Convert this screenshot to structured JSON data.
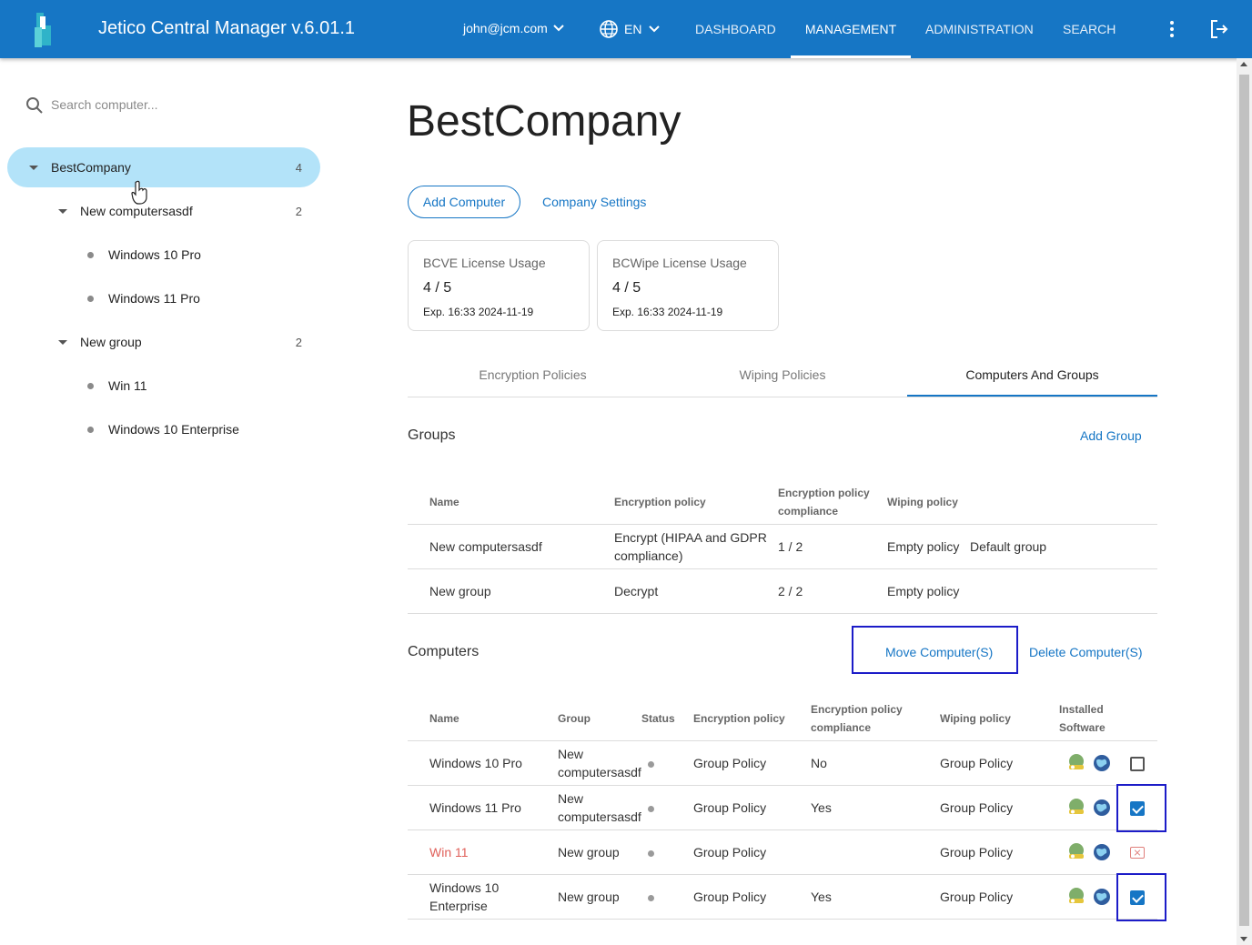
{
  "header": {
    "app_title": "Jetico Central Manager  v.6.01.1",
    "user": "john@jcm.com",
    "language": "EN",
    "nav": [
      {
        "label": "DASHBOARD"
      },
      {
        "label": "MANAGEMENT"
      },
      {
        "label": "ADMINISTRATION"
      },
      {
        "label": "SEARCH"
      }
    ],
    "active_nav": "MANAGEMENT",
    "colors": {
      "bar": "#1676c5",
      "accent": "#1676c5",
      "selected_tree": "#b3e3f9",
      "highlight": "#1c1cc8",
      "danger": "#e0605a"
    }
  },
  "sidebar": {
    "search_placeholder": "Search computer...",
    "tree": {
      "root": {
        "label": "BestCompany",
        "count": "4"
      },
      "groups": [
        {
          "label": "New computersasdf",
          "count": "2",
          "children": [
            "Windows 10 Pro",
            "Windows 11 Pro"
          ]
        },
        {
          "label": "New group",
          "count": "2",
          "children": [
            "Win 11",
            "Windows 10 Enterprise"
          ]
        }
      ]
    }
  },
  "main": {
    "title": "BestCompany",
    "add_computer": "Add Computer",
    "company_settings": "Company Settings",
    "cards": [
      {
        "title": "BCVE License Usage",
        "value": "4 / 5",
        "exp": "Exp. 16:33 2024-11-19"
      },
      {
        "title": "BCWipe License Usage",
        "value": "4 / 5",
        "exp": "Exp. 16:33 2024-11-19"
      }
    ],
    "tabs": [
      "Encryption Policies",
      "Wiping Policies",
      "Computers And Groups"
    ],
    "active_tab": "Computers And Groups",
    "groups": {
      "title": "Groups",
      "add_group": "Add Group",
      "headers": {
        "name": "Name",
        "enc_policy": "Encryption policy",
        "enc_compliance_1": "Encryption policy",
        "enc_compliance_2": "compliance",
        "wiping": "Wiping policy"
      },
      "rows": [
        {
          "name": "New computersasdf",
          "enc_policy": "Encrypt (HIPAA and GDPR compliance)",
          "compliance": "1 / 2",
          "wiping": "Empty policy",
          "extra": "Default group"
        },
        {
          "name": "New group",
          "enc_policy": "Decrypt",
          "compliance": "2 / 2",
          "wiping": "Empty policy",
          "extra": ""
        }
      ]
    },
    "computers": {
      "title": "Computers",
      "move": "Move Computer(S)",
      "delete": "Delete Computer(S)",
      "headers": {
        "name": "Name",
        "group": "Group",
        "status": "Status",
        "enc_policy": "Encryption policy",
        "enc_compliance_1": "Encryption policy",
        "enc_compliance_2": "compliance",
        "wiping": "Wiping policy",
        "software_1": "Installed",
        "software_2": "Software"
      },
      "rows": [
        {
          "name": "Windows 10 Pro",
          "group": "New computersasdf",
          "enc_policy": "Group Policy",
          "compliance": "No",
          "wiping": "Group Policy",
          "checked": false,
          "disabled": false
        },
        {
          "name": "Windows 11 Pro",
          "group": "New computersasdf",
          "enc_policy": "Group Policy",
          "compliance": "Yes",
          "wiping": "Group Policy",
          "checked": true,
          "disabled": false
        },
        {
          "name": "Win 11",
          "group": "New group",
          "enc_policy": "Group Policy",
          "compliance": "",
          "wiping": "Group Policy",
          "checked": false,
          "disabled": true
        },
        {
          "name": "Windows 10 Enterprise",
          "group": "New group",
          "enc_policy": "Group Policy",
          "compliance": "Yes",
          "wiping": "Group Policy",
          "checked": true,
          "disabled": false
        }
      ]
    }
  }
}
